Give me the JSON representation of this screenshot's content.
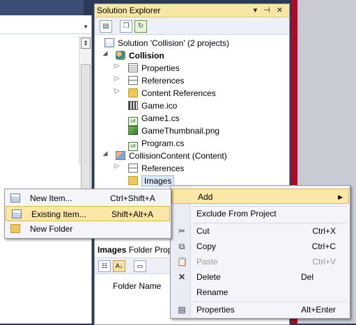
{
  "solution_explorer": {
    "title": "Solution Explorer",
    "title_buttons": "▾ ⊣ ✕",
    "toolbar_icons": [
      "properties-icon",
      "show-all-files-icon",
      "refresh-icon"
    ]
  },
  "tree": {
    "solution": "Solution 'Collision' (2 projects)",
    "project": "Collision",
    "properties": "Properties",
    "references": "References",
    "content_references": "Content References",
    "game_ico": "Game.ico",
    "game1_cs": "Game1.cs",
    "thumbnail": "GameThumbnail.png",
    "program_cs": "Program.cs",
    "content_project": "CollisionContent (Content)",
    "content_refs": "References",
    "images": "Images",
    "cs_badge": "c#"
  },
  "properties_pane": {
    "title_bold": "Images",
    "title_rest": " Folder Prop",
    "folder_name": "Folder Name"
  },
  "context_menu": {
    "add": "Add",
    "exclude": "Exclude From Project",
    "cut": "Cut",
    "cut_shortcut": "Ctrl+X",
    "copy": "Copy",
    "copy_shortcut": "Ctrl+C",
    "paste": "Paste",
    "paste_shortcut": "Ctrl+V",
    "delete": "Delete",
    "delete_shortcut": "Del",
    "rename": "Rename",
    "properties": "Properties",
    "properties_shortcut": "Alt+Enter"
  },
  "submenu": {
    "new_item": "New Item...",
    "new_item_shortcut": "Ctrl+Shift+A",
    "existing_item": "Existing Item...",
    "existing_item_shortcut": "Shift+Alt+A",
    "new_folder": "New Folder"
  },
  "colors": {
    "title_bar": "#f6e7a5",
    "highlight": "#fbe7a6",
    "accent_red": "#b00a24"
  }
}
